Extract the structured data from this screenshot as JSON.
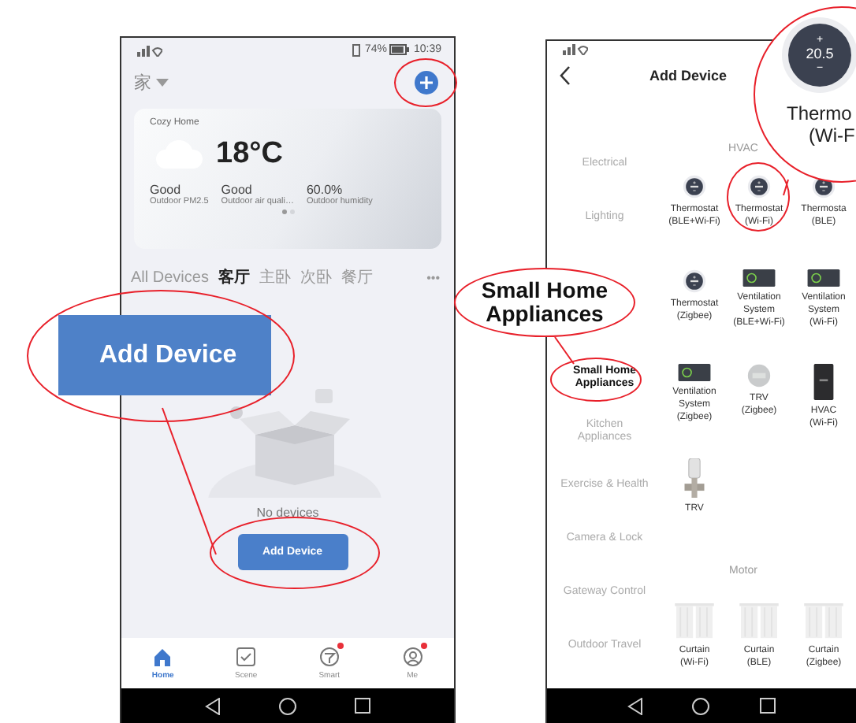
{
  "home_screen": {
    "status_bar": {
      "battery": "74%",
      "time": "10:39"
    },
    "home_name": "家",
    "weather": {
      "title": "Cozy Home",
      "temperature": "18°C",
      "stats": [
        {
          "value": "Good",
          "label": "Outdoor PM2.5"
        },
        {
          "value": "Good",
          "label": "Outdoor air quali…"
        },
        {
          "value": "60.0%",
          "label": "Outdoor humidity"
        }
      ],
      "pages": [
        {
          "selected": true
        },
        {
          "selected": false
        }
      ]
    },
    "room_tabs": [
      {
        "label": "All Devices",
        "selected": false
      },
      {
        "label": "客厅",
        "selected": true
      },
      {
        "label": "主卧",
        "selected": false
      },
      {
        "label": "次卧",
        "selected": false
      },
      {
        "label": "餐厅",
        "selected": false
      }
    ],
    "more": "•••",
    "empty_message": "No devices",
    "add_button": {
      "label": "Add Device",
      "circled": true
    },
    "add_icon_circled": true,
    "nav": [
      {
        "label": "Home",
        "kind": "home",
        "selected": true,
        "badge": false
      },
      {
        "label": "Scene",
        "kind": "scene",
        "selected": false,
        "badge": false
      },
      {
        "label": "Smart",
        "kind": "smart",
        "selected": false,
        "badge": true
      },
      {
        "label": "Me",
        "kind": "me",
        "selected": false,
        "badge": true
      }
    ]
  },
  "add_device_screen": {
    "title": "Add Device",
    "categories": [
      {
        "label": "Electrical",
        "selected": false,
        "circled": false
      },
      {
        "label": "Lighting",
        "selected": false,
        "circled": false
      },
      {
        "label": "Small Home Appliances",
        "selected": true,
        "circled": true
      },
      {
        "label": "Kitchen Appliances",
        "selected": false,
        "circled": false
      },
      {
        "label": "Exercise & Health",
        "selected": false,
        "circled": false
      },
      {
        "label": "Camera & Lock",
        "selected": false,
        "circled": false
      },
      {
        "label": "Gateway Control",
        "selected": false,
        "circled": false
      },
      {
        "label": "Outdoor Travel",
        "selected": false,
        "circled": false
      }
    ],
    "sections": [
      {
        "title": "HVAC",
        "rows": [
          [
            {
              "kind": "thermostat",
              "lines": [
                "Thermostat",
                "(BLE+Wi-Fi)"
              ],
              "circled": false
            },
            {
              "kind": "thermostat",
              "lines": [
                "Thermostat",
                "(Wi-Fi)"
              ],
              "circled": true
            },
            {
              "kind": "thermostat",
              "lines": [
                "Thermosta",
                "(BLE)"
              ],
              "circled": false
            }
          ],
          [
            {
              "kind": "thermostat",
              "lines": [
                "Thermostat",
                "(Zigbee)"
              ],
              "circled": false
            },
            {
              "kind": "ventilation",
              "lines": [
                "Ventilation",
                "System",
                "(BLE+Wi-Fi)"
              ],
              "circled": false
            },
            {
              "kind": "ventilation",
              "lines": [
                "Ventilation",
                "System",
                "(Wi-Fi)"
              ],
              "circled": false
            }
          ],
          [
            {
              "kind": "ventilation",
              "lines": [
                "Ventilation",
                "System",
                "(Zigbee)"
              ],
              "circled": false
            },
            {
              "kind": "trv_head",
              "lines": [
                "TRV",
                "(Zigbee)"
              ],
              "circled": false
            },
            {
              "kind": "hvac_panel",
              "lines": [
                "HVAC",
                "(Wi-Fi)"
              ],
              "circled": false
            }
          ],
          [
            {
              "kind": "valve",
              "lines": [
                "TRV"
              ],
              "circled": false
            }
          ]
        ]
      },
      {
        "title": "Motor",
        "rows": [
          [
            {
              "kind": "curtain",
              "lines": [
                "Curtain",
                "(Wi-Fi)"
              ],
              "circled": false
            },
            {
              "kind": "curtain",
              "lines": [
                "Curtain",
                "(BLE)"
              ],
              "circled": false
            },
            {
              "kind": "curtain",
              "lines": [
                "Curtain",
                "(Zigbee)"
              ],
              "circled": false
            }
          ]
        ]
      }
    ]
  },
  "callouts": [
    {
      "kind": "button",
      "text": "Add Device"
    },
    {
      "kind": "label",
      "text": "Small Home Appliances"
    },
    {
      "kind": "zoom",
      "display": [
        "+",
        "20.5",
        "−"
      ],
      "lines": [
        "Thermo",
        "(Wi-F"
      ]
    }
  ]
}
